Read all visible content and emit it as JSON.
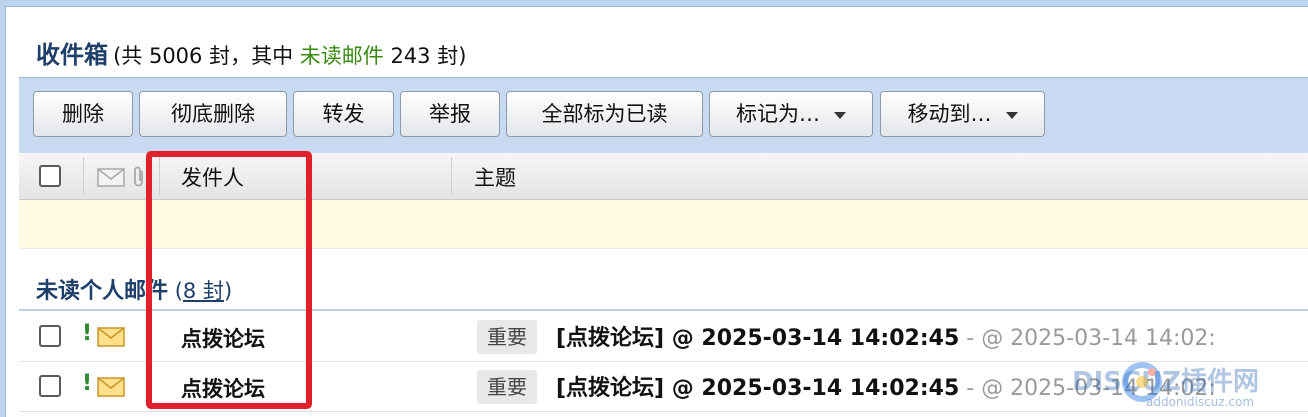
{
  "folder": {
    "title": "收件箱",
    "count_prefix": "(共 5006 封，其中 ",
    "unread_label": "未读邮件",
    "count_suffix": " 243 封)"
  },
  "toolbar": {
    "buttons": [
      "删除",
      "彻底删除",
      "转发",
      "举报",
      "全部标为已读",
      "标记为…",
      "移动到…"
    ]
  },
  "columns": {
    "sender": "发件人",
    "subject": "主题"
  },
  "group": {
    "title": "未读个人邮件",
    "count_open": " (",
    "count_link": "8 封",
    "count_close": ")"
  },
  "rows": [
    {
      "flag": "!",
      "sender": "点拨论坛",
      "tag": "重要",
      "subject": "[点拨论坛] @ 2025-03-14 14:02:45",
      "preview": " - @ 2025-03-14 14:02:"
    },
    {
      "flag": "!",
      "sender": "点拨论坛",
      "tag": "重要",
      "subject": "[点拨论坛] @ 2025-03-14 14:02:45",
      "preview": " - @ 2025-03-14 14:02:"
    }
  ],
  "watermark": {
    "text": "DISCUZ插件网",
    "sub": "addonidiscuz.com"
  },
  "colors": {
    "accent_blue": "#1f3f6b",
    "unread_green": "#3a8a12",
    "highlight_red": "#e0212b",
    "toolbar_bg": "#c7daf2"
  }
}
